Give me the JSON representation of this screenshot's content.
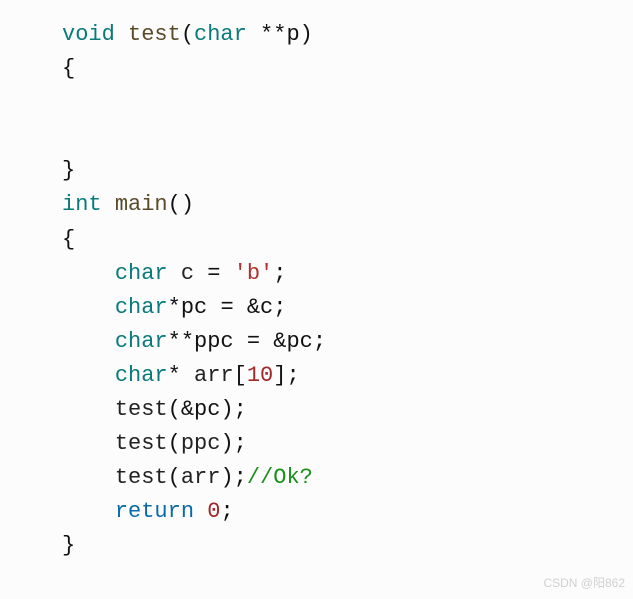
{
  "code": {
    "line1": {
      "kw_void": "void",
      "sp1": " ",
      "fn_test": "test",
      "open_paren": "(",
      "kw_char": "char",
      "sp2": " ",
      "stars_p": "**p",
      "close_paren": ")"
    },
    "line2": {
      "brace_open": "{"
    },
    "line3": {
      "empty": ""
    },
    "line4": {
      "empty": ""
    },
    "line5": {
      "brace_close": "}"
    },
    "line6": {
      "kw_int": "int",
      "sp1": " ",
      "fn_main": "main",
      "open_paren": "(",
      "close_paren": ")"
    },
    "line7": {
      "brace_open": "{"
    },
    "line8": {
      "indent": "    ",
      "kw_char": "char",
      "sp1": " ",
      "id_c": "c",
      "sp2": " ",
      "eq": "=",
      "sp3": " ",
      "lit_b": "'b'",
      "semi": ";"
    },
    "line9": {
      "indent": "    ",
      "kw_char": "char",
      "star_pc": "*pc",
      "sp1": " ",
      "eq": "=",
      "sp2": " ",
      "amp_c": "&c",
      "semi": ";"
    },
    "line10": {
      "indent": "    ",
      "kw_char": "char",
      "stars_ppc": "**ppc",
      "sp1": " ",
      "eq": "=",
      "sp2": " ",
      "amp_pc": "&pc",
      "semi": ";"
    },
    "line11": {
      "indent": "    ",
      "kw_char": "char",
      "star": "*",
      "sp1": " ",
      "id_arr": "arr",
      "open_b": "[",
      "num_10": "10",
      "close_b": "]",
      "semi": ";"
    },
    "line12": {
      "indent": "    ",
      "fn_test": "test",
      "open_paren": "(",
      "amp_pc": "&pc",
      "close_paren": ")",
      "semi": ";"
    },
    "line13": {
      "indent": "    ",
      "fn_test": "test",
      "open_paren": "(",
      "id_ppc": "ppc",
      "close_paren": ")",
      "semi": ";"
    },
    "line14": {
      "indent": "    ",
      "fn_test": "test",
      "open_paren": "(",
      "id_arr": "arr",
      "close_paren": ")",
      "semi": ";",
      "comment": "//Ok?"
    },
    "line15": {
      "indent": "    ",
      "kw_return": "return",
      "sp1": " ",
      "num_0": "0",
      "semi": ";"
    },
    "line16": {
      "brace_close": "}"
    }
  },
  "watermark": "CSDN @阳862"
}
